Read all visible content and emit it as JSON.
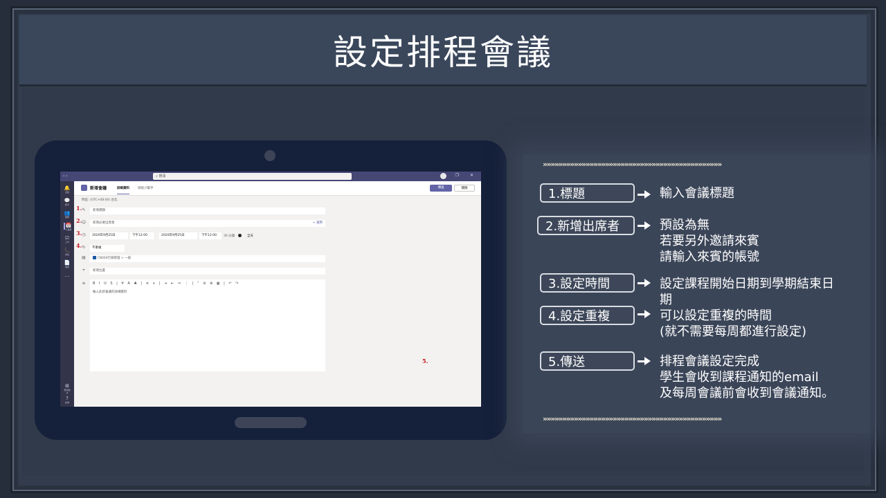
{
  "slide": {
    "title": "設定排程會議"
  },
  "teams": {
    "search_placeholder": "搜尋",
    "window_controls": "– ❐ ✕",
    "app_title": "新增會議",
    "tab_details": "詳細資料",
    "tab_assistant": "排程小幫手",
    "send_label": "傳送",
    "close_label": "關閉",
    "timezone": "時區: (UTC+08:00) 台北",
    "title_placeholder": "新增標題",
    "attendees_placeholder": "新增必要出席者",
    "optional_label": "+ 選用",
    "start_date": "2020年9月25日",
    "start_time": "下午12:00",
    "end_date": "2020年9月25日",
    "end_time": "下午12:00",
    "duration": "30 分鐘",
    "allday_label": "全天",
    "repeat_value": "不重複",
    "channel_value": "CN004行銷管理 > 一般",
    "location_placeholder": "新增位置",
    "editor_placeholder": "輸入此新會議的詳細資料",
    "rail": [
      "活動",
      "聊天",
      "團隊",
      "行事曆",
      "工作",
      "通話",
      "檔案",
      "應用程式",
      "說明"
    ]
  },
  "markers": [
    "1.",
    "2.",
    "3.",
    "4.",
    "5."
  ],
  "chevrons": "»»»»»»»»»»»»»»»»»»»»»»»»»»»»»»»»»»»»»»»»»»»»»»",
  "steps": [
    {
      "label": "1.標題",
      "desc": [
        "輸入會議標題"
      ]
    },
    {
      "label": "2.新增出席者",
      "desc": [
        "預設為無",
        "若要另外邀請來賓",
        "請輸入來賓的帳號"
      ]
    },
    {
      "label": "3.設定時間",
      "desc": [
        "設定課程開始日期到學期結束日",
        "期"
      ]
    },
    {
      "label": "4.設定重複",
      "desc": [
        "可以設定重複的時間",
        "(就不需要每周都進行設定)"
      ]
    },
    {
      "label": "5.傳送",
      "desc": [
        "排程會議設定完成",
        "學生會收到課程通知的email",
        "及每周會議前會收到會議通知。"
      ]
    }
  ]
}
